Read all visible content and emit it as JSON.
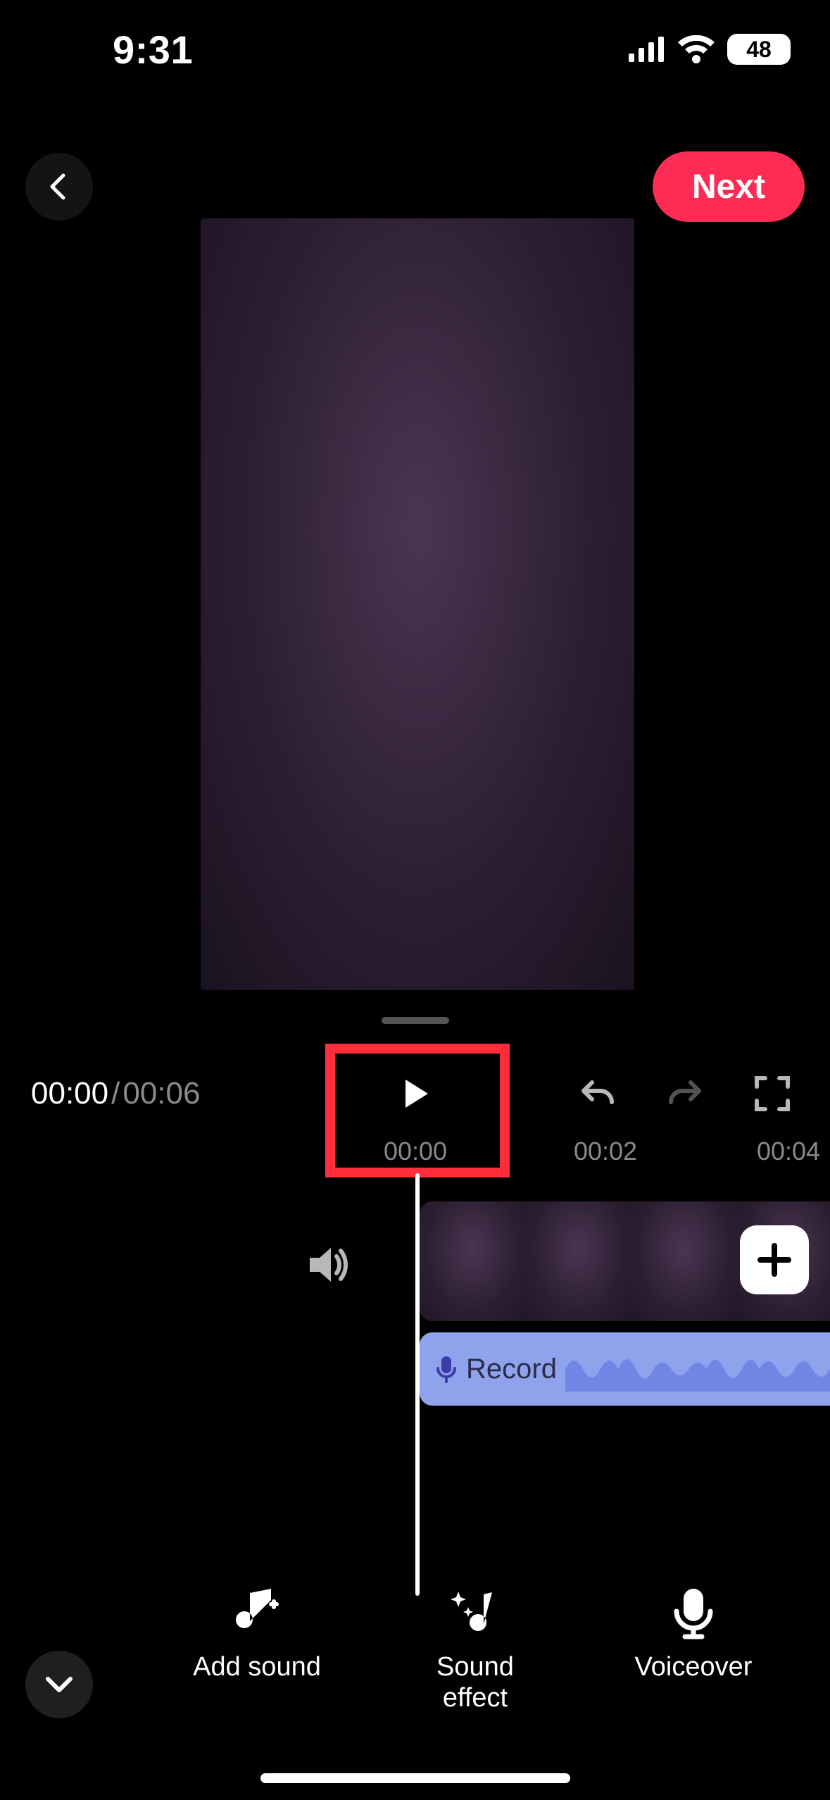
{
  "status": {
    "time": "9:31",
    "battery_pct": "48"
  },
  "header": {
    "next_label": "Next"
  },
  "playback": {
    "current_time": "00:00",
    "separator": "/",
    "total_time": "00:06"
  },
  "ruler": {
    "ticks": [
      "00:00",
      "00:02",
      "00:04"
    ]
  },
  "audio_track": {
    "label": "Record"
  },
  "tools": [
    {
      "id": "add-sound",
      "label": "Add sound"
    },
    {
      "id": "sound-effect",
      "label": "Sound\neffect"
    },
    {
      "id": "voiceover",
      "label": "Voiceover"
    }
  ]
}
